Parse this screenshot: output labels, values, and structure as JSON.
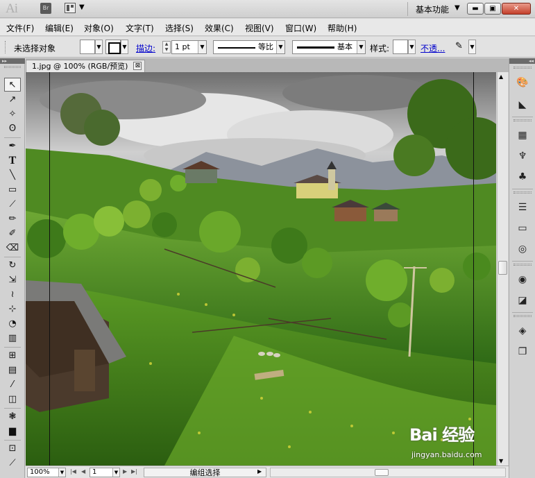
{
  "titlebar": {
    "app_logo": "Ai",
    "bridge_label": "Br",
    "workspace": "基本功能",
    "icons": [
      "arrange-documents-icon",
      "minimize-icon",
      "restore-icon",
      "close-icon"
    ]
  },
  "menu": {
    "items": [
      "文件(F)",
      "编辑(E)",
      "对象(O)",
      "文字(T)",
      "选择(S)",
      "效果(C)",
      "视图(V)",
      "窗口(W)",
      "帮助(H)"
    ]
  },
  "controlbar": {
    "selection_status": "未选择对象",
    "stroke_link": "描边:",
    "stroke_weight": "1 pt",
    "profile_label": "等比",
    "brush_label": "基本",
    "style_label": "样式:",
    "opacity_link": "不透..."
  },
  "document": {
    "tab_title": "1.jpg @ 100% (RGB/预览)",
    "close_glyph": "⊠"
  },
  "statusbar": {
    "zoom": "100%",
    "artboard": "1",
    "status": "编组选择"
  },
  "watermark": {
    "logo": "Bai 经验",
    "url": "jingyan.baidu.com"
  },
  "tools": [
    "selection-tool-icon",
    "direct-selection-tool-icon",
    "magic-wand-tool-icon",
    "lasso-tool-icon",
    "pen-tool-icon",
    "type-tool-icon",
    "line-segment-tool-icon",
    "rectangle-tool-icon",
    "paintbrush-tool-icon",
    "pencil-tool-icon",
    "blob-brush-tool-icon",
    "eraser-tool-icon",
    "rotate-tool-icon",
    "scale-tool-icon",
    "warp-tool-icon",
    "free-transform-tool-icon",
    "shape-builder-tool-icon",
    "perspective-grid-tool-icon",
    "mesh-tool-icon",
    "gradient-tool-icon",
    "eyedropper-tool-icon",
    "blend-tool-icon",
    "symbol-sprayer-tool-icon",
    "column-graph-tool-icon",
    "artboard-tool-icon",
    "slice-tool-icon"
  ],
  "panels": [
    "color-panel-icon",
    "color-guide-panel-icon",
    "swatches-panel-icon",
    "brushes-panel-icon",
    "symbols-panel-icon",
    "stroke-panel-icon",
    "gradient-panel-icon",
    "transparency-panel-icon",
    "appearance-panel-icon",
    "graphic-styles-panel-icon",
    "layers-panel-icon",
    "artboards-panel-icon"
  ]
}
